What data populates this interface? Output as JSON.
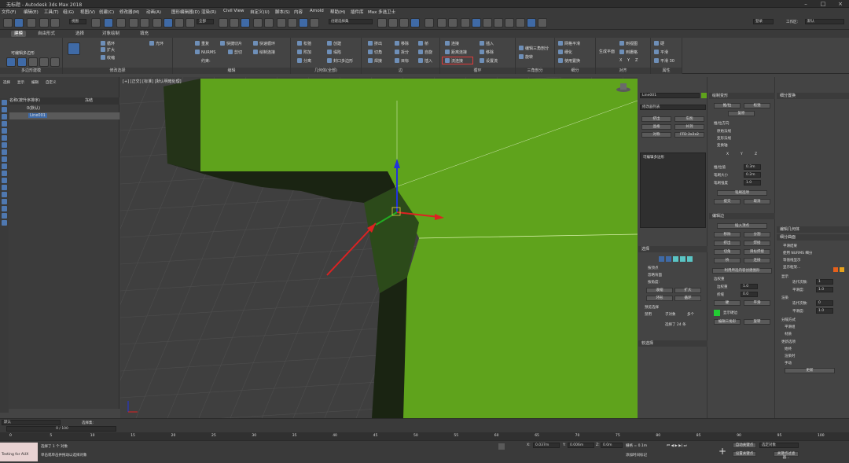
{
  "app": {
    "title": "无标题 - Autodesk 3ds Max 2018",
    "user_label": "登录",
    "workspace_label": "工作区:",
    "workspace_value": "默认"
  },
  "menu": [
    "文件(F)",
    "编辑(E)",
    "工具(T)",
    "组(G)",
    "视图(V)",
    "创建(C)",
    "修改器(M)",
    "动画(A)",
    "图形编辑器(D)",
    "渲染(R)",
    "Civil View",
    "自定义(U)",
    "脚本(S)",
    "内容",
    "Arnold",
    "帮助(H)",
    "插件库",
    "Max 多选卫士"
  ],
  "quick": {
    "view_dropdown": "视图",
    "selset_placeholder": "创建选择集",
    "all_dropdown": "全部"
  },
  "ribbon_tabs": [
    "建模",
    "自由形式",
    "选择",
    "对象绘制",
    "填充"
  ],
  "ribbon": {
    "poly_modeling": {
      "title": "多边形建模",
      "btn": "可编辑多边形"
    },
    "modify_sel": {
      "title": "修改选择",
      "items": [
        "循环",
        "扩大",
        "收缩",
        "光环"
      ]
    },
    "edit": {
      "title": "编辑",
      "items": [
        "重复",
        "快捷切片",
        "快速循环",
        "NURMS",
        "剪切",
        "绘制连接",
        "约束:"
      ]
    },
    "geometry": {
      "title": "几何体(全部)",
      "items": [
        "松弛",
        "创建",
        "附加",
        "塌陷",
        "分离",
        "封口多边形"
      ]
    },
    "edges": {
      "title": "边",
      "items": [
        "挤出",
        "移除",
        "桥",
        "切角",
        "拆分",
        "自旋",
        "焊接",
        "目标",
        "插入"
      ]
    },
    "loops": {
      "title": "循环",
      "items": [
        "连接",
        "插入",
        "距离连接",
        "移除",
        "流连接",
        "设置流"
      ]
    },
    "tris": {
      "title": "三角剖分",
      "items": [
        "编辑三角剖分",
        "旋转"
      ]
    },
    "subdiv": {
      "title": "细分",
      "items": [
        "网格平滑",
        "细化",
        "使用置换"
      ]
    },
    "align": {
      "title": "对齐",
      "items": [
        "生成平面",
        "到视图",
        "到栅格",
        "X",
        "Y",
        "Z"
      ]
    },
    "props": {
      "title": "属性",
      "items": [
        "硬",
        "平滑",
        "平滑 30"
      ]
    }
  },
  "scene_explorer": {
    "menu": [
      "选择",
      "显示",
      "编辑",
      "自定义"
    ],
    "header": "名称(按升序排序)",
    "header2": "冻结",
    "rows": [
      "0(默认)",
      "Line001"
    ]
  },
  "viewport": {
    "label": "[+] [正交] [标准] [默认明暗处理]"
  },
  "modifier_panel": {
    "object_name": "Line001",
    "modifier_list": "修改器列表",
    "buttons": [
      "挤出",
      "车削",
      "晶格",
      "补洞",
      "对称",
      "FFD 2x2x2"
    ],
    "stack_item": "可编辑多边形",
    "selection_title": "选择",
    "selection_opts": [
      "按顶点",
      "忽略背面",
      "按角度:"
    ],
    "sel_buttons": [
      "收缩",
      "扩大",
      "环形",
      "循环"
    ],
    "preview_title": "预览选择",
    "preview_opts": [
      "禁用",
      "子对象",
      "多个"
    ],
    "sel_status": "选择了 24 条",
    "softsel_title": "软选择"
  },
  "edit_edges": {
    "title": "编辑边",
    "insert_vertex": "插入顶点",
    "buttons": [
      "移除",
      "分割",
      "挤出",
      "焊接",
      "切角",
      "目标焊接",
      "桥",
      "连接"
    ],
    "create_shape": "利用所选内容创建图形",
    "weight_label": "边权重",
    "weight": "1.0",
    "crease_label": "折缝",
    "crease": "0.0",
    "hard": "硬",
    "smooth": "平滑",
    "display_hard": "显示硬边",
    "edit_tri": "编辑三角形",
    "rotate": "旋转"
  },
  "paint_deform": {
    "title": "绘制变形",
    "buttons": [
      "推/拉",
      "松弛",
      "复原"
    ],
    "dir_label": "推/拉方向",
    "dir_opts": [
      "原始法线",
      "变形法线",
      "变换轴"
    ],
    "xyz": [
      "X",
      "Y",
      "Z"
    ],
    "values": [
      [
        "推/拉值",
        "0.3m"
      ],
      [
        "笔刷大小",
        "0.2m"
      ],
      [
        "笔刷强度",
        "1.0"
      ]
    ],
    "brush_opts": "笔刷选项",
    "commit": "提交",
    "cancel": "取消"
  },
  "subdiv_surface": {
    "title": "细分曲面",
    "opts": [
      "平滑结果",
      "使用 NURMS 细分",
      "等值线显示",
      "显示框架..."
    ],
    "display_label": "显示",
    "iter_label": "迭代次数:",
    "iter_value": "1",
    "smooth_label": "平滑度:",
    "smooth_value": "1.0",
    "render_label": "渲染",
    "render_iter": "0",
    "render_smooth": "1.0",
    "sep_label": "分隔方式",
    "sep_opts": [
      "平滑组",
      "材质"
    ],
    "update_label": "更新选项",
    "update_opts": [
      "始终",
      "渲染时",
      "手动"
    ],
    "update_btn": "更新",
    "subdiv_disp": "细分置换",
    "edit_geo": "编辑几何体"
  },
  "timeline": {
    "frame": "0 / 100",
    "ticks": [
      "0",
      "5",
      "10",
      "15",
      "20",
      "25",
      "30",
      "35",
      "40",
      "45",
      "50",
      "55",
      "60",
      "65",
      "70",
      "75",
      "80",
      "85",
      "90",
      "95",
      "100"
    ]
  },
  "status": {
    "listener": "Testing for AUX",
    "line1": "选择了 1 个 对象",
    "line2": "单击或单击并拖动以选择对象",
    "x": "0.037m",
    "y": "0.006m",
    "z": "0.0m",
    "grid": "栅格 = 0.1m",
    "autokey": "自动关键点",
    "selected": "选定对象",
    "setkey": "设置关键点",
    "filter": "关键点过滤器...",
    "addtime": "添加时间标记",
    "layer_prompt": "选择集:",
    "layer_default": "默认"
  },
  "colors": {
    "green": "#5fa31c",
    "bg": "#444444",
    "accent": "#3f6aa6",
    "highlight": "#e03a3a"
  }
}
